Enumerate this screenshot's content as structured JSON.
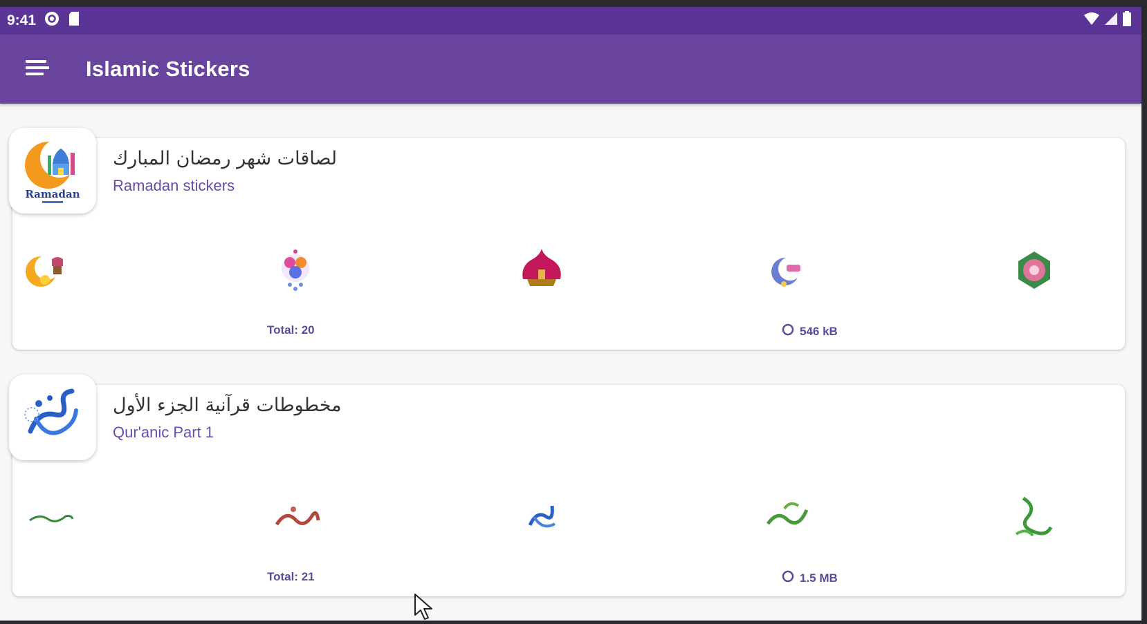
{
  "status_bar": {
    "time": "9:41"
  },
  "app_bar": {
    "title": "Islamic Stickers",
    "menu_icon": "menu-icon"
  },
  "packs": [
    {
      "name": "لصاقات شهر رمضان المبارك",
      "publisher": "Ramadan stickers",
      "total": "Total: 20",
      "size": "546 kB",
      "tray_text": "Ramadan",
      "stickers": [
        "crescent-lantern-sticker",
        "lantern-flowers-sticker",
        "mosque-dome-sticker",
        "crescent-moon-sticker",
        "floral-lantern-sticker"
      ]
    },
    {
      "name": "مخطوطات قرآنية الجزء الأول",
      "publisher": "Qur'anic Part 1",
      "total": "Total: 21",
      "size": "1.5 MB",
      "stickers": [
        "calligraphy-line-sticker",
        "calligraphy-red-sticker",
        "calligraphy-blue-sticker",
        "calligraphy-green-sticker",
        "calligraphy-green-vertical-sticker"
      ]
    }
  ],
  "colors": {
    "status_bar": "#5a3596",
    "app_bar": "#68449f",
    "publisher": "#6a4bb0",
    "background": "#f7f7f7"
  }
}
